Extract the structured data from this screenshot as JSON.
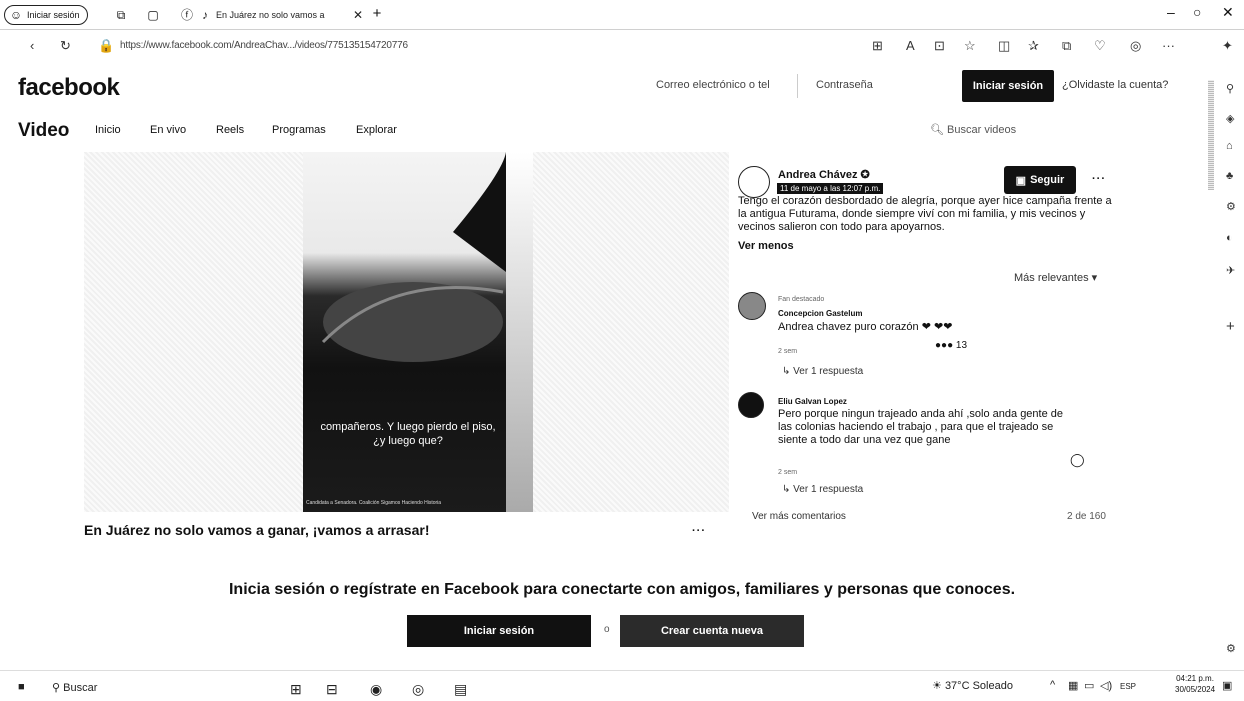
{
  "browser": {
    "tab1_label": "Iniciar sesión",
    "active_tab_title": "En Juárez no solo vamos a",
    "url": "https://www.facebook.com/AndreaChav.../videos/775135154720776"
  },
  "header": {
    "logo": "facebook",
    "email_placeholder": "Correo electrónico o tel",
    "password_placeholder": "Contraseña",
    "login_button": "Iniciar sesión",
    "forgot_link": "¿Olvidaste la cuenta?"
  },
  "nav": {
    "title": "Video",
    "items": [
      "Inicio",
      "En vivo",
      "Reels",
      "Programas",
      "Explorar"
    ],
    "search_placeholder": "Buscar videos"
  },
  "video": {
    "caption": "compañeros. Y luego pierdo el piso, ¿y luego que?",
    "credit": "Candidata a Senadora. Coalición Sigamos Haciendo Historia",
    "title": "En Juárez no solo vamos a ganar, ¡vamos a arrasar!",
    "more": "···"
  },
  "post": {
    "author": "Andrea Chávez ✪",
    "date": "11 de mayo a las 12:07 p.m.",
    "follow_button": "Seguir",
    "more": "···",
    "text": "Tengo el corazón desbordado de alegría, porque ayer hice campaña frente a la antigua Futurama, donde siempre viví con mi familia, y mis vecinos y vecinos salieron con todo para apoyarnos.",
    "see_less": "Ver menos",
    "sort_label": "Más relevantes ▾"
  },
  "comments": [
    {
      "badge": "Fan destacado",
      "name": "Concepcion Gastelum",
      "text": "Andrea chavez puro corazón ❤ ❤❤",
      "meta": "2 sem",
      "reactions": "13",
      "reply": "↳ Ver 1 respuesta"
    },
    {
      "name": "Eliu Galvan Lopez",
      "text": "Pero porque ningun trajeado anda ahí ,solo anda gente de las colonias haciendo el trabajo , para que el trajeado se siente a todo dar una vez que gane",
      "meta": "2 sem",
      "reply": "↳ Ver 1 respuesta"
    }
  ],
  "comments_footer": {
    "more": "Ver más comentarios",
    "count": "2 de 160"
  },
  "prompt": {
    "text": "Inicia sesión o regístrate en Facebook para conectarte con amigos, familiares y personas que conoces.",
    "login_button": "Iniciar sesión",
    "separator": "o",
    "create_button": "Crear cuenta nueva"
  },
  "taskbar": {
    "search": "Buscar",
    "weather": "37°C Soleado",
    "lang": "ESP",
    "time": "04:21 p.m.",
    "date": "30/05/2024"
  }
}
